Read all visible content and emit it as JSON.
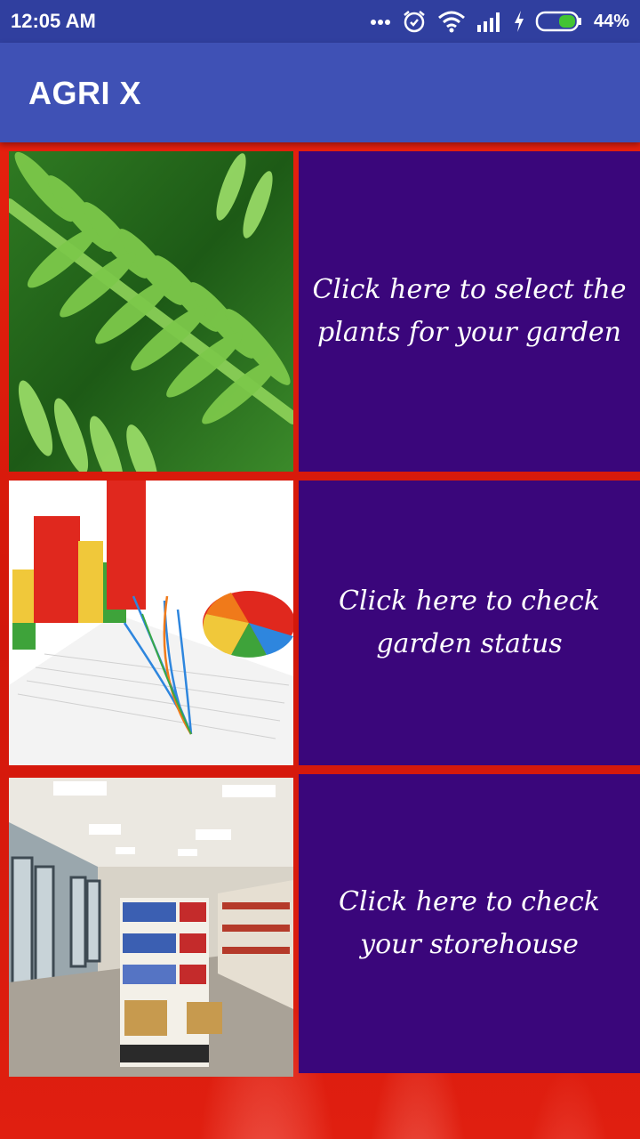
{
  "status_bar": {
    "time": "12:05 AM",
    "battery_percent": "44%",
    "icons": [
      "more-dots-icon",
      "alarm-icon",
      "wifi-icon",
      "signal-icon",
      "charging-icon",
      "battery-icon"
    ],
    "battery_level": 0.44
  },
  "app_bar": {
    "title": "AGRI X",
    "color": "#3f51b5"
  },
  "tiles": [
    {
      "image": "fern-leaves-image",
      "text": "Click here to select the plants for your garden"
    },
    {
      "image": "charts-graphs-image",
      "text": "Click here to check garden status"
    },
    {
      "image": "store-shelves-image",
      "text": "Click here to check your storehouse"
    }
  ],
  "colors": {
    "status_bar": "#303f9f",
    "tile_background": "#3a067b",
    "page_background": "#d81a0c"
  }
}
